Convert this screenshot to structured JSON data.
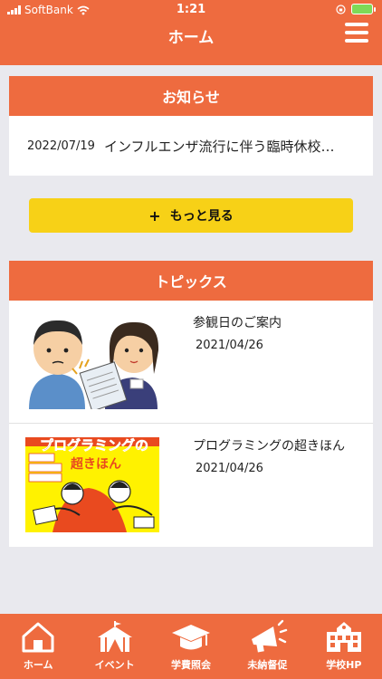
{
  "status_bar": {
    "carrier": "SoftBank",
    "time": "1:21"
  },
  "header": {
    "title": "ホーム"
  },
  "news": {
    "heading": "お知らせ",
    "items": [
      {
        "date": "2022/07/19",
        "title": "インフルエンザ流行に伴う臨時休校…"
      }
    ]
  },
  "more_button": {
    "label": "もっと見る",
    "icon": "+"
  },
  "topics": {
    "heading": "トピックス",
    "items": [
      {
        "title": "参観日のご案内",
        "date": "2021/04/26"
      },
      {
        "title": "プログラミングの超きほん",
        "date": "2021/04/26"
      }
    ],
    "book_cover": {
      "title_line1": "プログラミングの",
      "title_line2": "超きほん"
    }
  },
  "tabbar": {
    "items": [
      {
        "label": "ホーム",
        "icon": "home-icon"
      },
      {
        "label": "イベント",
        "icon": "circus-tent-icon"
      },
      {
        "label": "学費照会",
        "icon": "graduation-cap-icon"
      },
      {
        "label": "未納督促",
        "icon": "megaphone-icon"
      },
      {
        "label": "学校HP",
        "icon": "school-building-icon"
      }
    ]
  },
  "colors": {
    "accent": "#ee6b3f",
    "button_yellow": "#f7d117",
    "background": "#e9e9ee"
  }
}
